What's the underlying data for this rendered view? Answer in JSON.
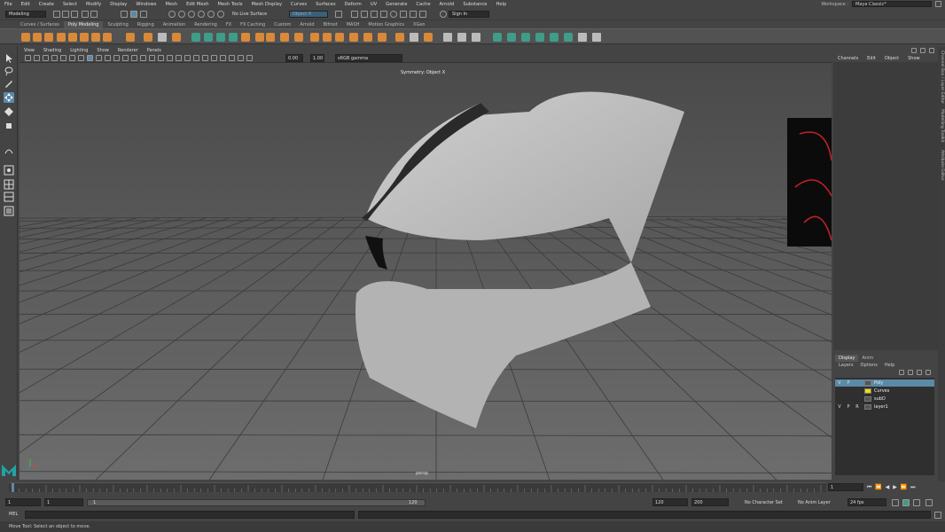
{
  "menubar": {
    "items": [
      "File",
      "Edit",
      "Create",
      "Select",
      "Modify",
      "Display",
      "Windows",
      "Mesh",
      "Edit Mesh",
      "Mesh Tools",
      "Mesh Display",
      "Curves",
      "Surfaces",
      "Deform",
      "UV",
      "Generate",
      "Cache",
      "Arnold",
      "Substance",
      "Help"
    ],
    "workspace_label": "Workspace :",
    "workspace_value": "Maya Classic*"
  },
  "statusline": {
    "mode": "Modeling",
    "live_surface": "No Live Surface",
    "symmetry": "Object X",
    "sign_in": "Sign In"
  },
  "shelf": {
    "tabs": [
      "Curves / Surfaces",
      "Poly Modeling",
      "Sculpting",
      "Rigging",
      "Animation",
      "Rendering",
      "FX",
      "FX Caching",
      "Custom",
      "Arnold",
      "Bifrost",
      "MASH",
      "Motion Graphics",
      "XGen"
    ],
    "active_tab": "Poly Modeling"
  },
  "panel": {
    "menus": [
      "View",
      "Shading",
      "Lighting",
      "Show",
      "Renderer",
      "Panels"
    ],
    "exposure": "0.00",
    "gamma": "1.00",
    "colorspace": "sRGB gamma",
    "symmetry_label": "Symmetry: Object X",
    "camera": "persp"
  },
  "channelbox": {
    "menus": [
      "Channels",
      "Edit",
      "Object",
      "Show"
    ],
    "side_tabs": [
      "Channel Box / Layer Editor",
      "Modelling Toolkit",
      "Attribute Editor"
    ]
  },
  "layers": {
    "tabs": [
      "Display",
      "Anim"
    ],
    "menus": [
      "Layers",
      "Options",
      "Help"
    ],
    "rows": [
      {
        "v": "V",
        "p": "P",
        "r": "",
        "color": "#555555",
        "name": "Poly",
        "selected": true
      },
      {
        "v": "",
        "p": "",
        "r": "",
        "color": "#f0e000",
        "name": "Curves",
        "selected": false
      },
      {
        "v": "",
        "p": "",
        "r": "",
        "color": "#555555",
        "name": "subD",
        "selected": false
      },
      {
        "v": "V",
        "p": "P",
        "r": "R",
        "color": "#555555",
        "name": "layer1",
        "selected": false
      }
    ]
  },
  "timeslider": {
    "current_frame": "1",
    "range_start": "1",
    "range_start2": "1",
    "range_inner_start": "1",
    "range_inner_end": "120",
    "range_end": "120",
    "range_end2": "200",
    "character_set": "No Character Set",
    "anim_layer": "No Anim Layer",
    "fps": "24 fps"
  },
  "cmdline": {
    "lang": "MEL"
  },
  "helpline": {
    "text": "Move Tool: Select an object to move."
  },
  "colors": {
    "accent": "#5a8aa8",
    "shelf_orange": "#d9893a",
    "shelf_teal": "#3f9c88",
    "viewport": "#6e6e6e"
  }
}
